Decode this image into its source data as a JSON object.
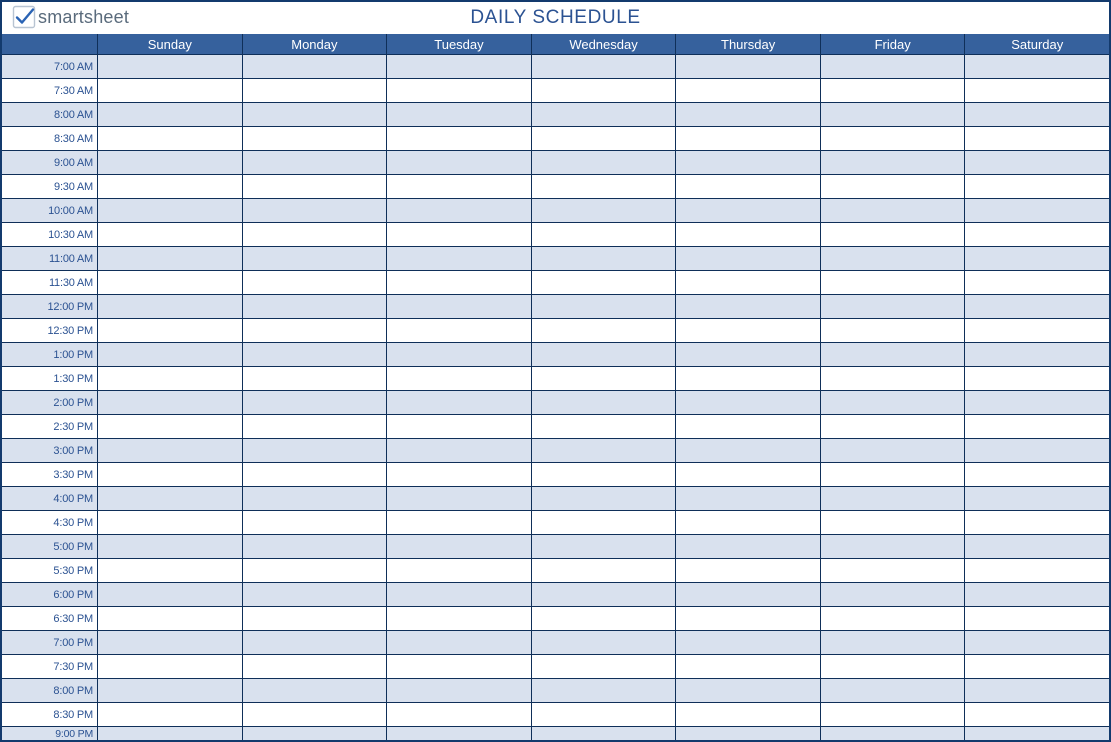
{
  "brand": {
    "name": "smartsheet"
  },
  "title": "DAILY SCHEDULE",
  "days": [
    "Sunday",
    "Monday",
    "Tuesday",
    "Wednesday",
    "Thursday",
    "Friday",
    "Saturday"
  ],
  "times": [
    "7:00 AM",
    "7:30 AM",
    "8:00 AM",
    "8:30 AM",
    "9:00 AM",
    "9:30 AM",
    "10:00 AM",
    "10:30 AM",
    "11:00 AM",
    "11:30 AM",
    "12:00 PM",
    "12:30 PM",
    "1:00 PM",
    "1:30 PM",
    "2:00 PM",
    "2:30 PM",
    "3:00 PM",
    "3:30 PM",
    "4:00 PM",
    "4:30 PM",
    "5:00 PM",
    "5:30 PM",
    "6:00 PM",
    "6:30 PM",
    "7:00 PM",
    "7:30 PM",
    "8:00 PM",
    "8:30 PM",
    "9:00 PM"
  ],
  "colors": {
    "header_bg": "#36619d",
    "alt_row_bg": "#d9e1ee",
    "border": "#0f2f59"
  }
}
